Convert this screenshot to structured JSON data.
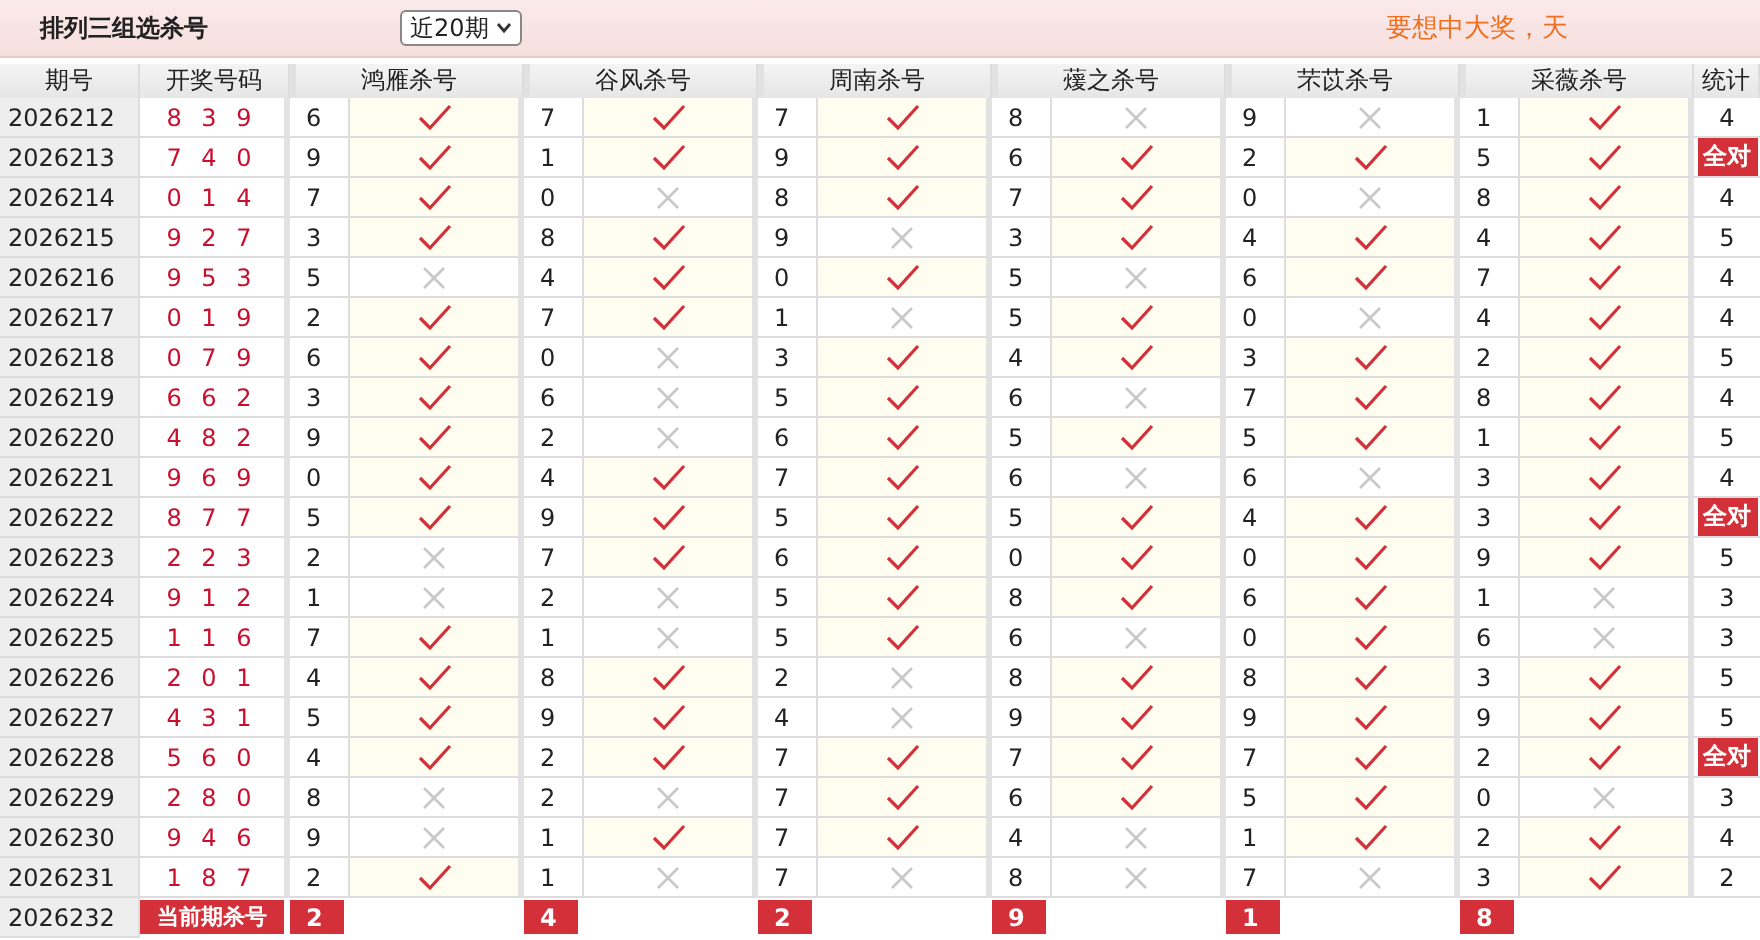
{
  "toolbar": {
    "title": "排列三组选杀号",
    "period_select": "近20期",
    "promo": "要想中大奖，天"
  },
  "table": {
    "columns": [
      "期号",
      "开奖号码",
      "鸿雁杀号",
      "谷风杀号",
      "周南杀号",
      "蕿之杀号",
      "芣苡杀号",
      "采薇杀号",
      "统计"
    ],
    "rows": [
      {
        "period": "2026212",
        "draw": "8 3 9",
        "kills": [
          {
            "number": "6",
            "hit": true
          },
          {
            "number": "7",
            "hit": true
          },
          {
            "number": "7",
            "hit": true
          },
          {
            "number": "8",
            "hit": false
          },
          {
            "number": "9",
            "hit": false
          },
          {
            "number": "1",
            "hit": true
          }
        ],
        "stat": "4",
        "all_correct": false
      },
      {
        "period": "2026213",
        "draw": "7 4 0",
        "kills": [
          {
            "number": "9",
            "hit": true
          },
          {
            "number": "1",
            "hit": true
          },
          {
            "number": "9",
            "hit": true
          },
          {
            "number": "6",
            "hit": true
          },
          {
            "number": "2",
            "hit": true
          },
          {
            "number": "5",
            "hit": true
          }
        ],
        "stat": "全对",
        "all_correct": true
      },
      {
        "period": "2026214",
        "draw": "0 1 4",
        "kills": [
          {
            "number": "7",
            "hit": true
          },
          {
            "number": "0",
            "hit": false
          },
          {
            "number": "8",
            "hit": true
          },
          {
            "number": "7",
            "hit": true
          },
          {
            "number": "0",
            "hit": false
          },
          {
            "number": "8",
            "hit": true
          }
        ],
        "stat": "4",
        "all_correct": false
      },
      {
        "period": "2026215",
        "draw": "9 2 7",
        "kills": [
          {
            "number": "3",
            "hit": true
          },
          {
            "number": "8",
            "hit": true
          },
          {
            "number": "9",
            "hit": false
          },
          {
            "number": "3",
            "hit": true
          },
          {
            "number": "4",
            "hit": true
          },
          {
            "number": "4",
            "hit": true
          }
        ],
        "stat": "5",
        "all_correct": false
      },
      {
        "period": "2026216",
        "draw": "9 5 3",
        "kills": [
          {
            "number": "5",
            "hit": false
          },
          {
            "number": "4",
            "hit": true
          },
          {
            "number": "0",
            "hit": true
          },
          {
            "number": "5",
            "hit": false
          },
          {
            "number": "6",
            "hit": true
          },
          {
            "number": "7",
            "hit": true
          }
        ],
        "stat": "4",
        "all_correct": false
      },
      {
        "period": "2026217",
        "draw": "0 1 9",
        "kills": [
          {
            "number": "2",
            "hit": true
          },
          {
            "number": "7",
            "hit": true
          },
          {
            "number": "1",
            "hit": false
          },
          {
            "number": "5",
            "hit": true
          },
          {
            "number": "0",
            "hit": false
          },
          {
            "number": "4",
            "hit": true
          }
        ],
        "stat": "4",
        "all_correct": false
      },
      {
        "period": "2026218",
        "draw": "0 7 9",
        "kills": [
          {
            "number": "6",
            "hit": true
          },
          {
            "number": "0",
            "hit": false
          },
          {
            "number": "3",
            "hit": true
          },
          {
            "number": "4",
            "hit": true
          },
          {
            "number": "3",
            "hit": true
          },
          {
            "number": "2",
            "hit": true
          }
        ],
        "stat": "5",
        "all_correct": false
      },
      {
        "period": "2026219",
        "draw": "6 6 2",
        "kills": [
          {
            "number": "3",
            "hit": true
          },
          {
            "number": "6",
            "hit": false
          },
          {
            "number": "5",
            "hit": true
          },
          {
            "number": "6",
            "hit": false
          },
          {
            "number": "7",
            "hit": true
          },
          {
            "number": "8",
            "hit": true
          }
        ],
        "stat": "4",
        "all_correct": false
      },
      {
        "period": "2026220",
        "draw": "4 8 2",
        "kills": [
          {
            "number": "9",
            "hit": true
          },
          {
            "number": "2",
            "hit": false
          },
          {
            "number": "6",
            "hit": true
          },
          {
            "number": "5",
            "hit": true
          },
          {
            "number": "5",
            "hit": true
          },
          {
            "number": "1",
            "hit": true
          }
        ],
        "stat": "5",
        "all_correct": false
      },
      {
        "period": "2026221",
        "draw": "9 6 9",
        "kills": [
          {
            "number": "0",
            "hit": true
          },
          {
            "number": "4",
            "hit": true
          },
          {
            "number": "7",
            "hit": true
          },
          {
            "number": "6",
            "hit": false
          },
          {
            "number": "6",
            "hit": false
          },
          {
            "number": "3",
            "hit": true
          }
        ],
        "stat": "4",
        "all_correct": false
      },
      {
        "period": "2026222",
        "draw": "8 7 7",
        "kills": [
          {
            "number": "5",
            "hit": true
          },
          {
            "number": "9",
            "hit": true
          },
          {
            "number": "5",
            "hit": true
          },
          {
            "number": "5",
            "hit": true
          },
          {
            "number": "4",
            "hit": true
          },
          {
            "number": "3",
            "hit": true
          }
        ],
        "stat": "全对",
        "all_correct": true
      },
      {
        "period": "2026223",
        "draw": "2 2 3",
        "kills": [
          {
            "number": "2",
            "hit": false
          },
          {
            "number": "7",
            "hit": true
          },
          {
            "number": "6",
            "hit": true
          },
          {
            "number": "0",
            "hit": true
          },
          {
            "number": "0",
            "hit": true
          },
          {
            "number": "9",
            "hit": true
          }
        ],
        "stat": "5",
        "all_correct": false
      },
      {
        "period": "2026224",
        "draw": "9 1 2",
        "kills": [
          {
            "number": "1",
            "hit": false
          },
          {
            "number": "2",
            "hit": false
          },
          {
            "number": "5",
            "hit": true
          },
          {
            "number": "8",
            "hit": true
          },
          {
            "number": "6",
            "hit": true
          },
          {
            "number": "1",
            "hit": false
          }
        ],
        "stat": "3",
        "all_correct": false
      },
      {
        "period": "2026225",
        "draw": "1 1 6",
        "kills": [
          {
            "number": "7",
            "hit": true
          },
          {
            "number": "1",
            "hit": false
          },
          {
            "number": "5",
            "hit": true
          },
          {
            "number": "6",
            "hit": false
          },
          {
            "number": "0",
            "hit": true
          },
          {
            "number": "6",
            "hit": false
          }
        ],
        "stat": "3",
        "all_correct": false
      },
      {
        "period": "2026226",
        "draw": "2 0 1",
        "kills": [
          {
            "number": "4",
            "hit": true
          },
          {
            "number": "8",
            "hit": true
          },
          {
            "number": "2",
            "hit": false
          },
          {
            "number": "8",
            "hit": true
          },
          {
            "number": "8",
            "hit": true
          },
          {
            "number": "3",
            "hit": true
          }
        ],
        "stat": "5",
        "all_correct": false
      },
      {
        "period": "2026227",
        "draw": "4 3 1",
        "kills": [
          {
            "number": "5",
            "hit": true
          },
          {
            "number": "9",
            "hit": true
          },
          {
            "number": "4",
            "hit": false
          },
          {
            "number": "9",
            "hit": true
          },
          {
            "number": "9",
            "hit": true
          },
          {
            "number": "9",
            "hit": true
          }
        ],
        "stat": "5",
        "all_correct": false
      },
      {
        "period": "2026228",
        "draw": "5 6 0",
        "kills": [
          {
            "number": "4",
            "hit": true
          },
          {
            "number": "2",
            "hit": true
          },
          {
            "number": "7",
            "hit": true
          },
          {
            "number": "7",
            "hit": true
          },
          {
            "number": "7",
            "hit": true
          },
          {
            "number": "2",
            "hit": true
          }
        ],
        "stat": "全对",
        "all_correct": true
      },
      {
        "period": "2026229",
        "draw": "2 8 0",
        "kills": [
          {
            "number": "8",
            "hit": false
          },
          {
            "number": "2",
            "hit": false
          },
          {
            "number": "7",
            "hit": true
          },
          {
            "number": "6",
            "hit": true
          },
          {
            "number": "5",
            "hit": true
          },
          {
            "number": "0",
            "hit": false
          }
        ],
        "stat": "3",
        "all_correct": false
      },
      {
        "period": "2026230",
        "draw": "9 4 6",
        "kills": [
          {
            "number": "9",
            "hit": false
          },
          {
            "number": "1",
            "hit": true
          },
          {
            "number": "7",
            "hit": true
          },
          {
            "number": "4",
            "hit": false
          },
          {
            "number": "1",
            "hit": true
          },
          {
            "number": "2",
            "hit": true
          }
        ],
        "stat": "4",
        "all_correct": false
      },
      {
        "period": "2026231",
        "draw": "1 8 7",
        "kills": [
          {
            "number": "2",
            "hit": true
          },
          {
            "number": "1",
            "hit": false
          },
          {
            "number": "7",
            "hit": false
          },
          {
            "number": "8",
            "hit": false
          },
          {
            "number": "7",
            "hit": false
          },
          {
            "number": "3",
            "hit": true
          }
        ],
        "stat": "2",
        "all_correct": false
      }
    ],
    "current": {
      "period": "2026232",
      "label": "当前期杀号",
      "kills": [
        "2",
        "4",
        "2",
        "9",
        "1",
        "8"
      ]
    }
  }
}
